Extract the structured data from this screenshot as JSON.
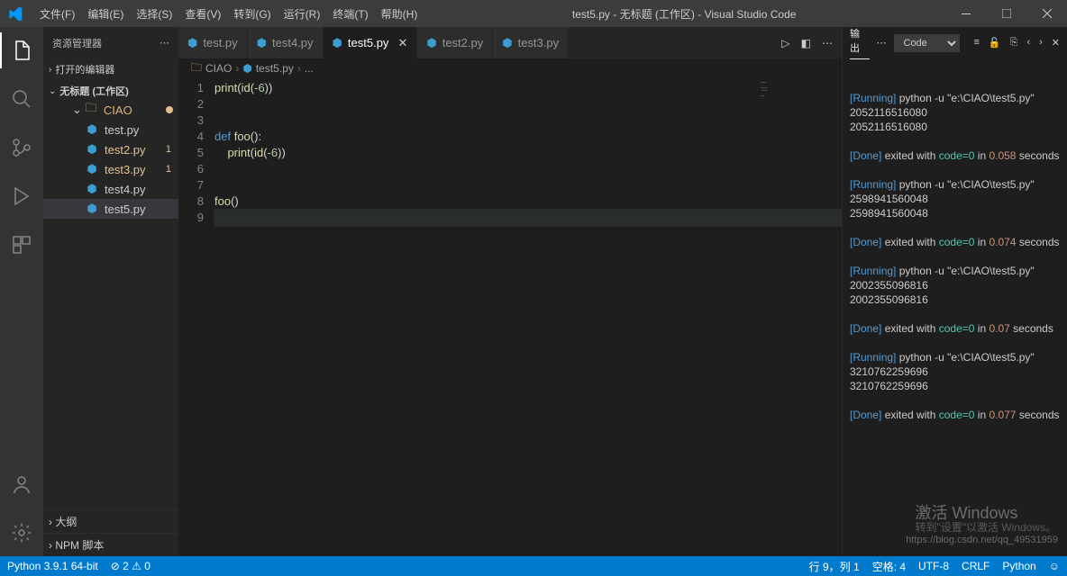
{
  "titlebar": {
    "menus": [
      "文件(F)",
      "编辑(E)",
      "选择(S)",
      "查看(V)",
      "转到(G)",
      "运行(R)",
      "终端(T)",
      "帮助(H)"
    ],
    "title": "test5.py - 无标题 (工作区) - Visual Studio Code"
  },
  "sidebar": {
    "header": "资源管理器",
    "openEditorsLabel": "打开的编辑器",
    "workspaceLabel": "无标题 (工作区)",
    "folder": "CIAO",
    "files": [
      {
        "name": "test.py",
        "modified": false,
        "badge": ""
      },
      {
        "name": "test2.py",
        "modified": true,
        "badge": "1"
      },
      {
        "name": "test3.py",
        "modified": true,
        "badge": "1"
      },
      {
        "name": "test4.py",
        "modified": false,
        "badge": ""
      },
      {
        "name": "test5.py",
        "modified": false,
        "badge": "",
        "selected": true
      }
    ],
    "outlineLabel": "大纲",
    "npmLabel": "NPM 脚本"
  },
  "tabs": [
    {
      "name": "test.py"
    },
    {
      "name": "test4.py"
    },
    {
      "name": "test5.py",
      "active": true
    },
    {
      "name": "test2.py"
    },
    {
      "name": "test3.py"
    }
  ],
  "breadcrumb": {
    "folder": "CIAO",
    "file": "test5.py",
    "more": "..."
  },
  "code": {
    "lines": [
      "1",
      "2",
      "3",
      "4",
      "5",
      "6",
      "7",
      "8",
      "9"
    ],
    "content": [
      {
        "html": "<span class='sy-fn'>print</span><span class='sy-punct'>(</span><span class='sy-fn'>id</span><span class='sy-punct'>(</span><span class='sy-num'>-6</span><span class='sy-punct'>))</span>"
      },
      {
        "html": ""
      },
      {
        "html": ""
      },
      {
        "html": "<span class='sy-kw'>def</span> <span class='sy-fn'>foo</span><span class='sy-punct'>():</span>"
      },
      {
        "html": "    <span class='sy-fn'>print</span><span class='sy-punct'>(</span><span class='sy-fn'>id</span><span class='sy-punct'>(</span><span class='sy-num'>-6</span><span class='sy-punct'>))</span>"
      },
      {
        "html": ""
      },
      {
        "html": ""
      },
      {
        "html": "<span class='sy-fn'>foo</span><span class='sy-punct'>()</span>"
      },
      {
        "html": "",
        "current": true
      }
    ]
  },
  "panel": {
    "title": "输出",
    "dropdown": "Code"
  },
  "output": [
    {
      "type": "running",
      "cmd": "python -u \"e:\\CIAO\\test5.py\""
    },
    {
      "type": "text",
      "text": "2052116516080"
    },
    {
      "type": "text",
      "text": "2052116516080"
    },
    {
      "type": "blank"
    },
    {
      "type": "done",
      "code": "0",
      "time": "0.058"
    },
    {
      "type": "blank"
    },
    {
      "type": "running",
      "cmd": "python -u \"e:\\CIAO\\test5.py\""
    },
    {
      "type": "text",
      "text": "2598941560048"
    },
    {
      "type": "text",
      "text": "2598941560048"
    },
    {
      "type": "blank"
    },
    {
      "type": "done",
      "code": "0",
      "time": "0.074"
    },
    {
      "type": "blank"
    },
    {
      "type": "running",
      "cmd": "python -u \"e:\\CIAO\\test5.py\""
    },
    {
      "type": "text",
      "text": "2002355096816"
    },
    {
      "type": "text",
      "text": "2002355096816"
    },
    {
      "type": "blank"
    },
    {
      "type": "done",
      "code": "0",
      "time": "0.07"
    },
    {
      "type": "blank"
    },
    {
      "type": "running",
      "cmd": "python -u \"e:\\CIAO\\test5.py\""
    },
    {
      "type": "text",
      "text": "3210762259696"
    },
    {
      "type": "text",
      "text": "3210762259696"
    },
    {
      "type": "blank"
    },
    {
      "type": "done",
      "code": "0",
      "time": "0.077"
    }
  ],
  "watermark": {
    "big": "激活 Windows",
    "small": "转到\"设置\"以激活 Windows。"
  },
  "urlmark": "https://blog.csdn.net/qq_49531959",
  "statusbar": {
    "python": "Python 3.9.1 64-bit",
    "errors": "⊘ 2 ⚠ 0",
    "line": "行 9，列 1",
    "spaces": "空格: 4",
    "encoding": "UTF-8",
    "eol": "CRLF",
    "lang": "Python",
    "feedback": "☺"
  }
}
